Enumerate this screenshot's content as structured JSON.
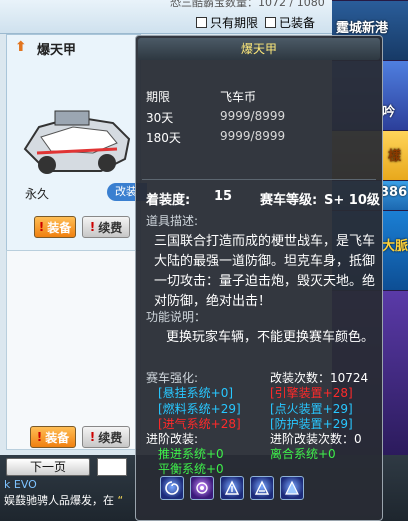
{
  "topbar": {
    "faded_text": "恐三酷霸宝数量：1072 / 1080",
    "only_expiring": "只有期限",
    "equipped": "已装备"
  },
  "card": {
    "title": "爆天甲",
    "duration": "永久",
    "tag": "改装",
    "equip_label": "装备",
    "renew_label": "续费"
  },
  "card2": {
    "equip_label": "装备",
    "renew_label": "续费"
  },
  "bottom": {
    "next_page": "下一页",
    "chat_line1": "k EVO",
    "chat_line2_prefix": "娱鼗驰骋人品爆发，在",
    "chat_line2_highlight": "“"
  },
  "side": {
    "tile1": "霆城新港",
    "tile2": "吟",
    "tile3": "樣",
    "tile4": "386",
    "tile5": "大脈"
  },
  "tooltip": {
    "title": "爆天甲",
    "price_header": {
      "period": "期限",
      "currency": "飞车币"
    },
    "prices": [
      {
        "period": "30天",
        "value": "9999/8999"
      },
      {
        "period": "180天",
        "value": "9999/8999"
      }
    ],
    "equip_degree_label": "着装度:",
    "equip_degree_value": "15",
    "car_level_label": "赛车等级:",
    "car_level_value": "S+ 10级",
    "desc_title": "道具描述:",
    "description": "三国联合打造而成的梗世战车，是飞车大陆的最强一道防御。坦克车身，抵御一切攻击：量子迫击炮，毁灭天地。绝对防御，绝对出击！",
    "func_title": "功能说明：",
    "func": "更换玩家车辆，不能更换赛车颜色。",
    "strengthen_title": "赛车强化:",
    "modify_count": "改装次数：10724",
    "strengthen": {
      "suspension": "[悬挂系统+0]",
      "engine": "[引擎装置+28]",
      "fuel": "[燃料系统+29]",
      "ignition": "[点火装置+29]",
      "intake": "[进气系统+28]",
      "defense": "[防护装置+29]"
    },
    "advanced_title": "进阶改装:",
    "advanced_count": "进阶改装次数：0",
    "advanced": {
      "push": "推进系统+0",
      "clutch": "离合系统+0",
      "balance": "平衡系统+0"
    },
    "skill_icons": [
      "swirl-icon",
      "purple-orb-icon",
      "triangle-icon",
      "triangle-icon",
      "triangle-icon"
    ]
  }
}
